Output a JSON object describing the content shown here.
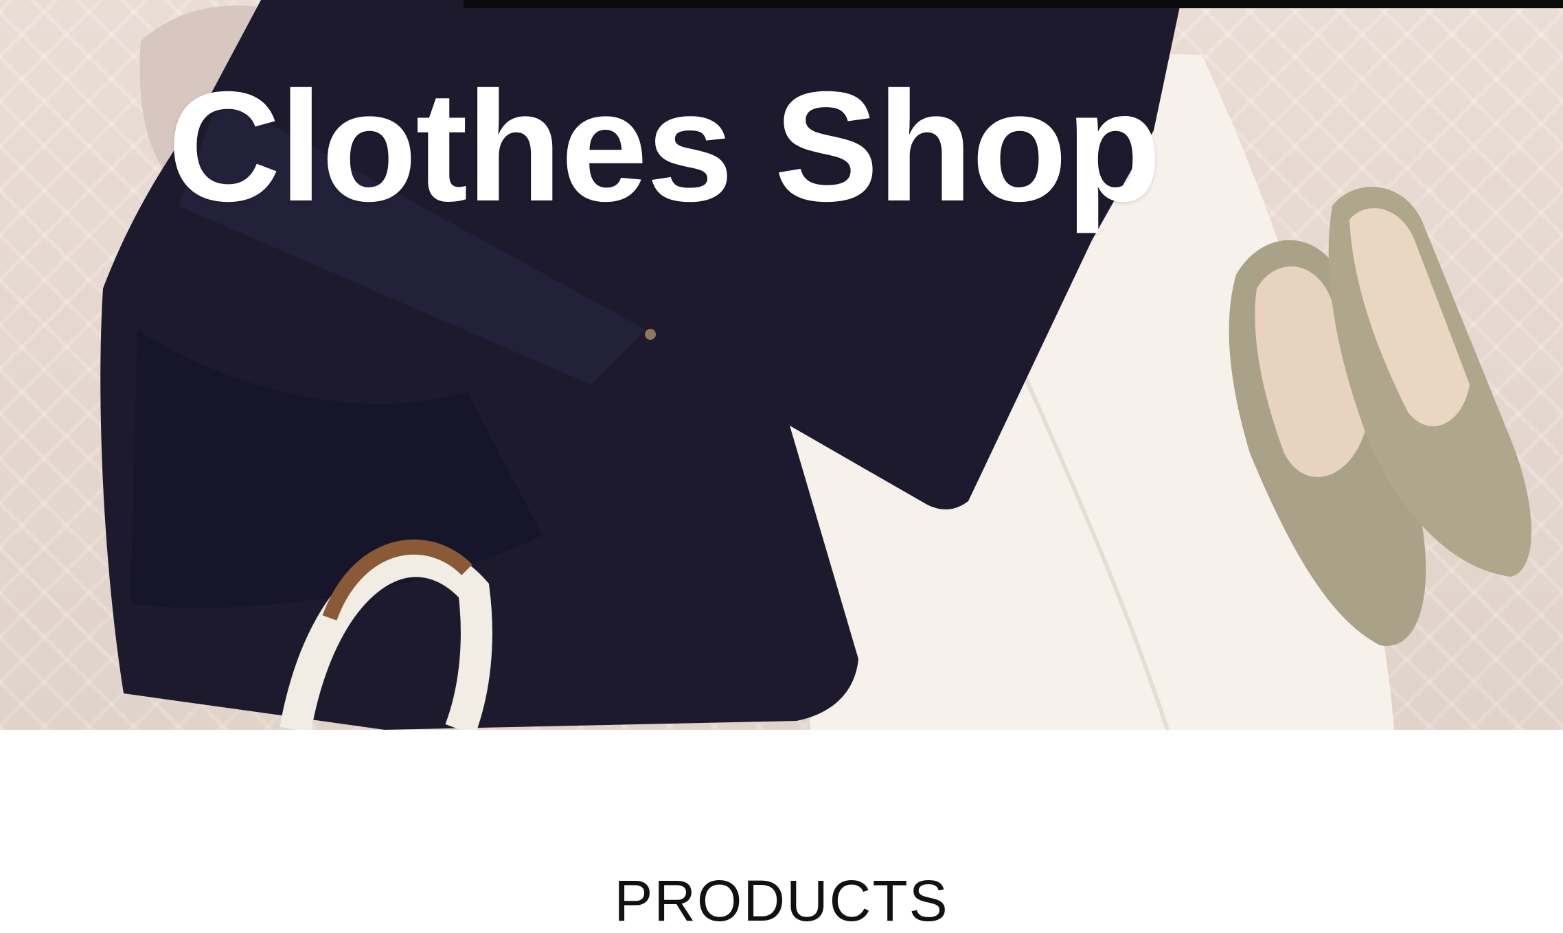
{
  "hero": {
    "title": "Clothes Shop",
    "image_alt": "clothes-flatlay-photo"
  },
  "products": {
    "heading": "PRODUCTS"
  },
  "colors": {
    "bedspread": "#efe0d8",
    "jacket": "#1c1a2c",
    "skirt": "#f7f1ec",
    "shoes": "#a9a188",
    "title_text": "#ffffff",
    "top_bar": "#0b0b0b"
  }
}
